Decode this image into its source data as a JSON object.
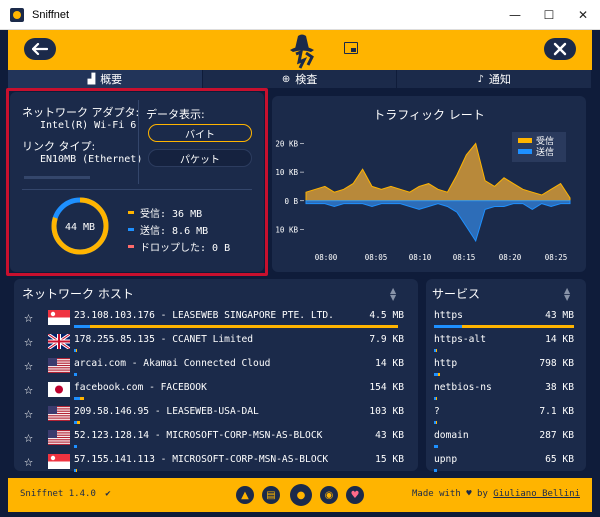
{
  "window": {
    "title": "Sniffnet",
    "minimize": "—",
    "maximize": "☐",
    "close": "✕"
  },
  "tabs": [
    {
      "label": "概要",
      "active": true
    },
    {
      "label": "検査",
      "active": false
    },
    {
      "label": "通知",
      "active": false
    }
  ],
  "adapter": {
    "title": "ネットワーク アダプタ:",
    "name": "Intel(R) Wi-Fi 6 A",
    "link_type_label": "リンク タイプ:",
    "link_type": "EN10MB (Ethernet)"
  },
  "data_display": {
    "label": "データ表示:",
    "bytes": "バイト",
    "packets": "パケット",
    "selected": "bytes"
  },
  "totals": {
    "center": "44 MB",
    "received_fraction": 0.8,
    "received": "受信: 36 MB",
    "sent": "送信: 8.6 MB",
    "dropped": "ドロップした: 0 B"
  },
  "traffic": {
    "title": "トラフィック レート",
    "legend_in": "受信",
    "legend_out": "送信",
    "yticks": [
      "20 KB",
      "10 KB",
      "0 B",
      "10 KB"
    ],
    "xticks": [
      "08:00",
      "08:05",
      "08:10",
      "08:15",
      "08:20",
      "08:25"
    ]
  },
  "chart_data": {
    "type": "area",
    "title": "トラフィック レート",
    "x": [
      0,
      1,
      2,
      3,
      4,
      5,
      6,
      7,
      8,
      9,
      10,
      11,
      12,
      13,
      14,
      15,
      16,
      17,
      18,
      19,
      20,
      21,
      22,
      23,
      24,
      25,
      26,
      27,
      28
    ],
    "series": [
      {
        "name": "受信",
        "values": [
          3,
          4,
          5,
          3,
          4,
          6,
          11,
          5,
          4,
          5,
          4,
          3,
          5,
          6,
          4,
          3,
          9,
          16,
          20,
          7,
          5,
          8,
          6,
          4,
          3,
          2,
          4,
          6,
          1
        ]
      },
      {
        "name": "送信",
        "values": [
          -1,
          -1,
          -1,
          -2,
          -1,
          -1,
          -1,
          -2,
          -1,
          -1,
          -1,
          -2,
          -3,
          -2,
          -1,
          -2,
          -4,
          -9,
          -14,
          -3,
          -2,
          -2,
          -1,
          -1,
          -3,
          -1,
          -2,
          -1,
          -1
        ]
      }
    ],
    "ylim": [
      -13,
      24
    ]
  },
  "hosts": {
    "title": "ネットワーク ホスト",
    "rows": [
      {
        "text": "23.108.103.176 - LEASEWEB SINGAPORE PTE. LTD.",
        "size": "4.5 MB",
        "flag": "sg",
        "fill": 1.0,
        "out": 0.05
      },
      {
        "text": "178.255.85.135 - CCANET Limited",
        "size": "7.9 KB",
        "flag": "uk",
        "fill": 0.01,
        "out": 0.005
      },
      {
        "text": "arcai.com - Akamai Connected Cloud",
        "size": "14 KB",
        "flag": "us",
        "fill": 0.01,
        "out": 0.01
      },
      {
        "text": "facebook.com - FACEBOOK",
        "size": "154 KB",
        "flag": "jp",
        "fill": 0.03,
        "out": 0.02
      },
      {
        "text": "209.58.146.95 - LEASEWEB-USA-DAL",
        "size": "103 KB",
        "flag": "us",
        "fill": 0.02,
        "out": 0.01
      },
      {
        "text": "52.123.128.14 - MICROSOFT-CORP-MSN-AS-BLOCK",
        "size": "43 KB",
        "flag": "us",
        "fill": 0.01,
        "out": 0.01
      },
      {
        "text": "57.155.141.113 - MICROSOFT-CORP-MSN-AS-BLOCK",
        "size": "15 KB",
        "flag": "sg",
        "fill": 0.01,
        "out": 0.005
      }
    ]
  },
  "services": {
    "title": "サービス",
    "rows": [
      {
        "name": "https",
        "size": "43 MB",
        "fill": 1.0,
        "out": 0.2
      },
      {
        "name": "https-alt",
        "size": "14 KB",
        "fill": 0.02,
        "out": 0.01
      },
      {
        "name": "http",
        "size": "798 KB",
        "fill": 0.04,
        "out": 0.03
      },
      {
        "name": "netbios-ns",
        "size": "38 KB",
        "fill": 0.02,
        "out": 0.01
      },
      {
        "name": "?",
        "size": "7.1 KB",
        "fill": 0.01,
        "out": 0.01
      },
      {
        "name": "domain",
        "size": "287 KB",
        "fill": 0.02,
        "out": 0.03
      },
      {
        "name": "upnp",
        "size": "65 KB",
        "fill": 0.01,
        "out": 0.02
      }
    ]
  },
  "footer": {
    "version": "Sniffnet 1.4.0",
    "check": "✔",
    "made_with": "Made with",
    "by": "by",
    "author": "Giuliano Bellini"
  },
  "colors": {
    "accent": "#ffb400",
    "bg": "#0f1c3a",
    "panel": "#1b2a4a",
    "in": "#ffb400",
    "out": "#1e90ff",
    "drop": "#ff6b6b"
  }
}
